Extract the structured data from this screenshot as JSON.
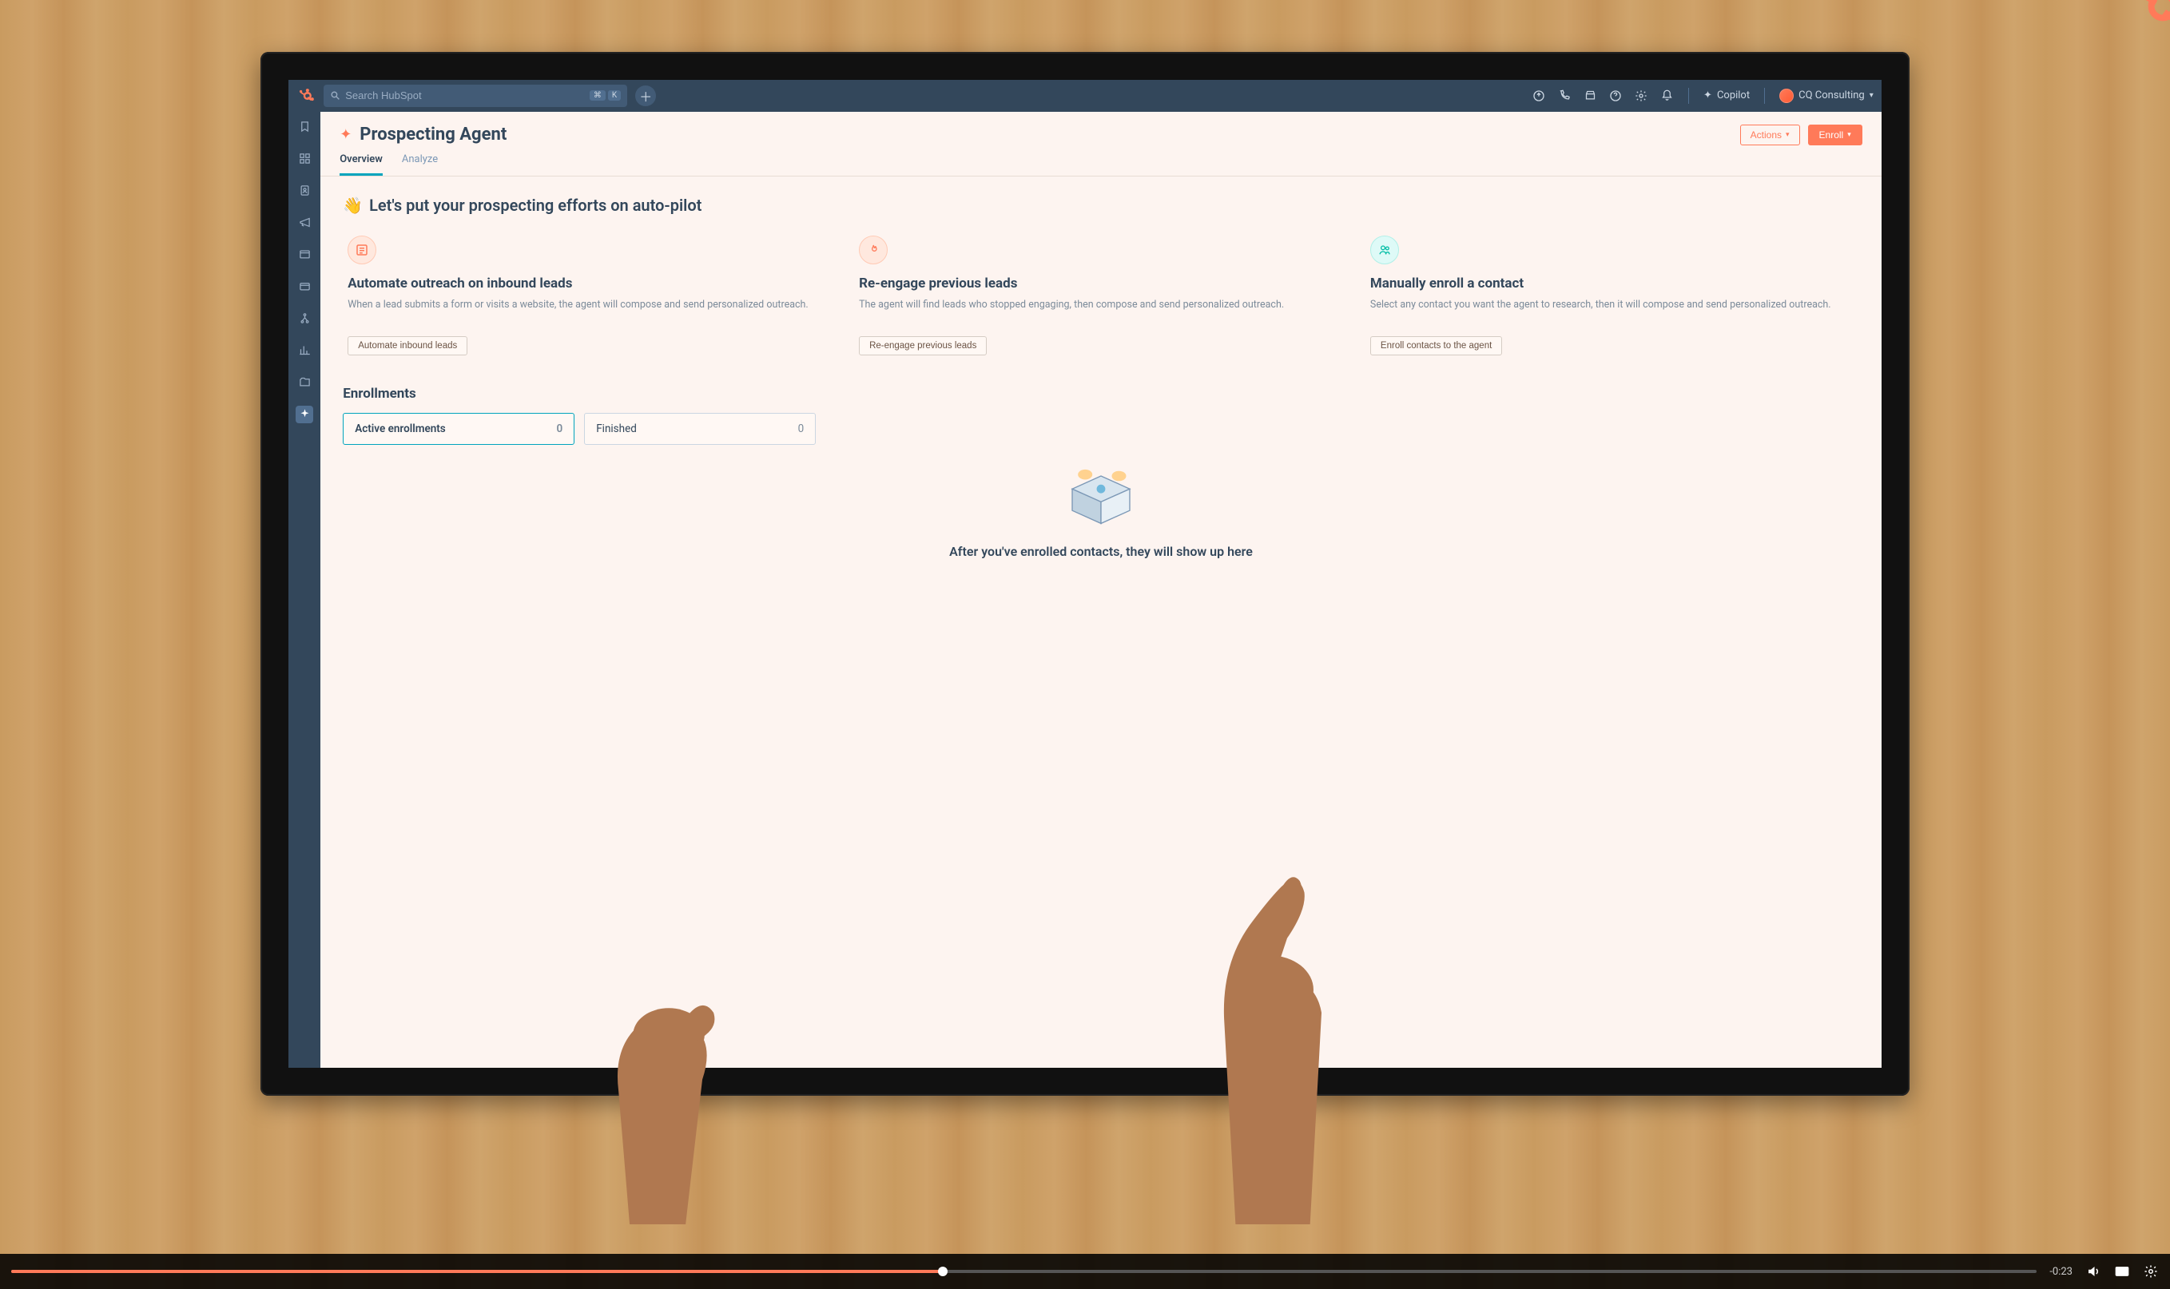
{
  "topbar": {
    "search_placeholder": "Search HubSpot",
    "kbd_cmd": "⌘",
    "kbd_k": "K",
    "copilot_label": "Copilot",
    "account_label": "CQ Consulting"
  },
  "page": {
    "title": "Prospecting Agent",
    "actions_label": "Actions",
    "enroll_label": "Enroll"
  },
  "tabs": [
    {
      "label": "Overview",
      "active": true
    },
    {
      "label": "Analyze",
      "active": false
    }
  ],
  "hero": {
    "emoji": "👋",
    "text": "Let's put your prospecting efforts on auto-pilot"
  },
  "cards": [
    {
      "icon": "list-icon",
      "icon_style": "orange",
      "title": "Automate outreach on inbound leads",
      "desc": "When a lead submits a form or visits a website, the agent will compose and send personalized outreach.",
      "button": "Automate inbound leads"
    },
    {
      "icon": "fire-icon",
      "icon_style": "orange",
      "title": "Re-engage previous leads",
      "desc": "The agent will find leads who stopped engaging, then compose and send personalized outreach.",
      "button": "Re-engage previous leads"
    },
    {
      "icon": "users-icon",
      "icon_style": "teal",
      "title": "Manually enroll a contact",
      "desc": "Select any contact you want the agent to research, then it will compose and send personalized outreach.",
      "button": "Enroll contacts to the agent"
    }
  ],
  "enrollments": {
    "heading": "Enrollments",
    "tabs": [
      {
        "label": "Active enrollments",
        "count": "0",
        "active": true
      },
      {
        "label": "Finished",
        "count": "0",
        "active": false
      }
    ],
    "empty_text": "After you've enrolled contacts, they will show up here"
  },
  "video": {
    "time_remaining": "-0:23"
  }
}
